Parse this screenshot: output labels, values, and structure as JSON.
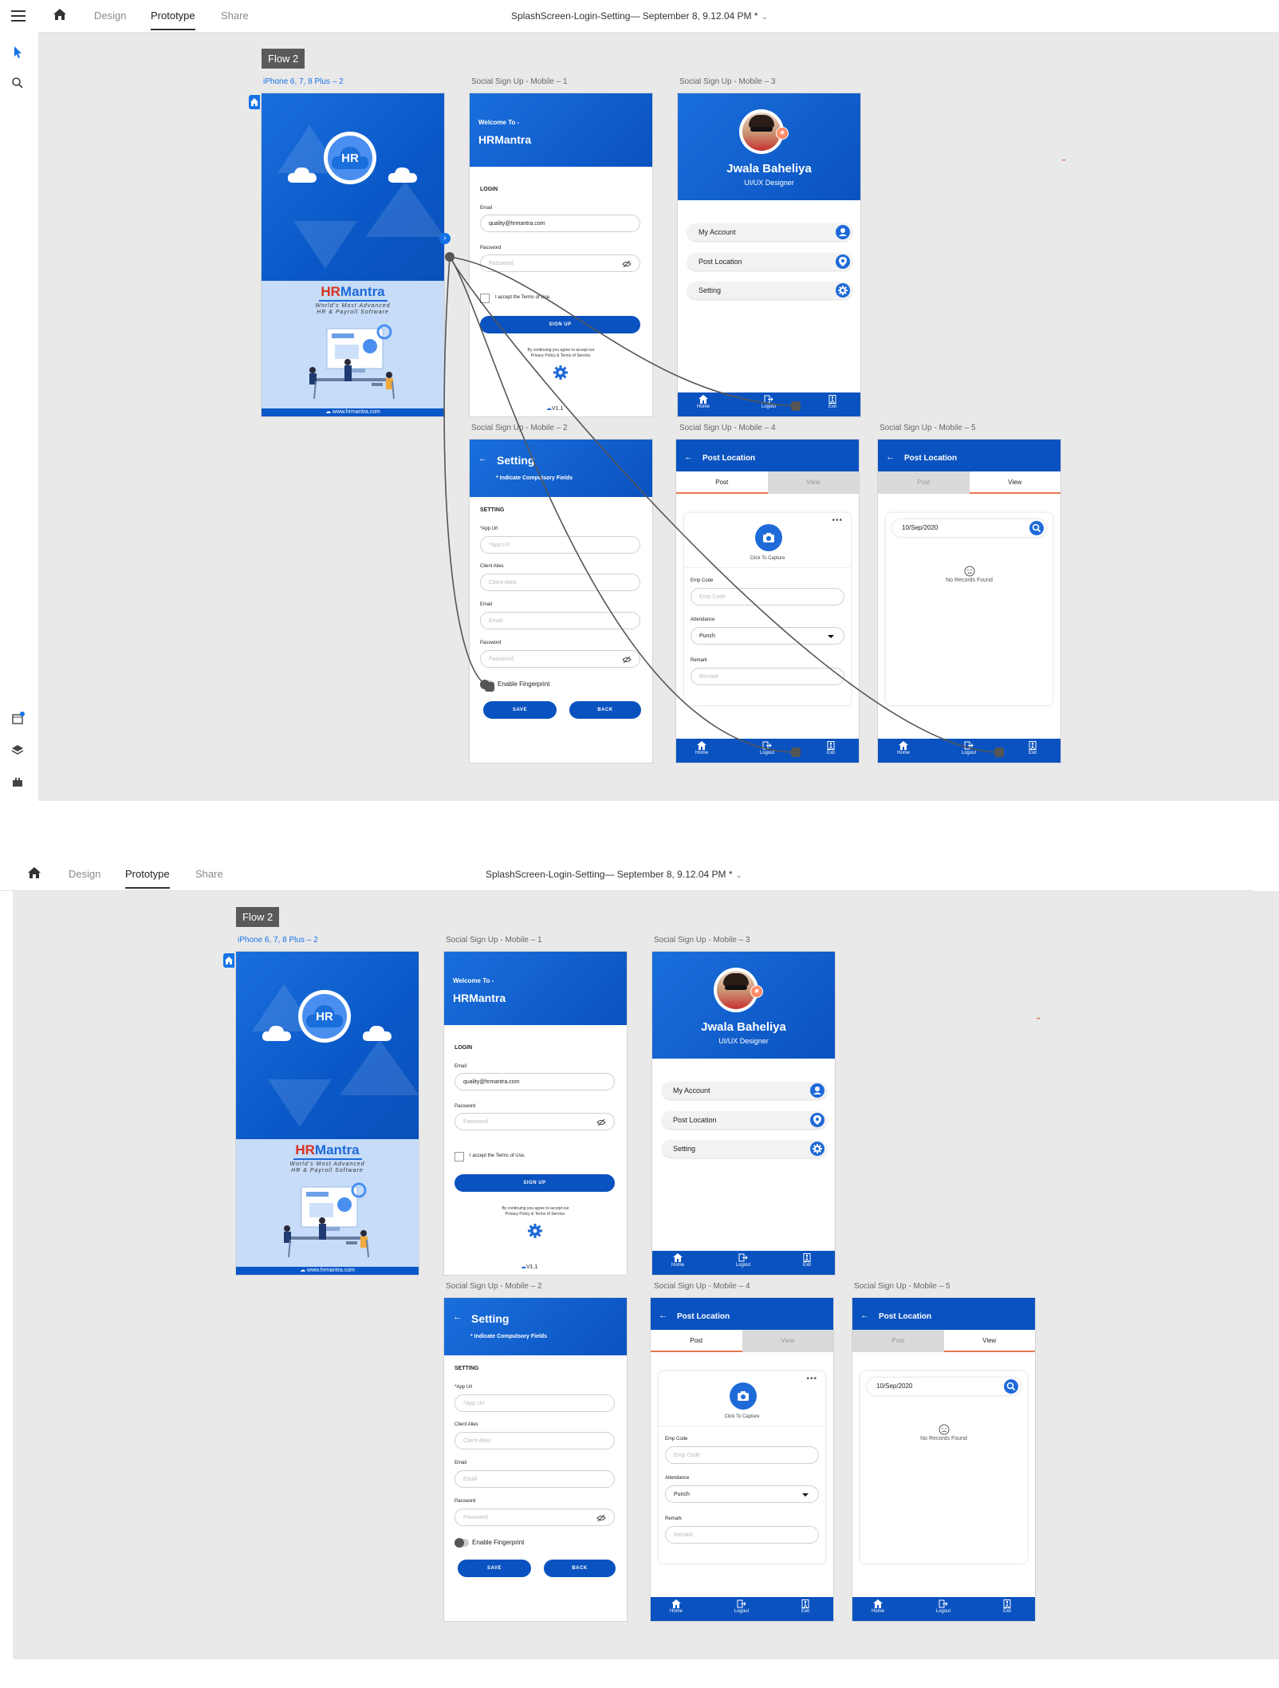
{
  "app": {
    "tabs": [
      {
        "label": "Design",
        "active": false
      },
      {
        "label": "Prototype",
        "active": true
      },
      {
        "label": "Share",
        "active": false
      }
    ],
    "doc_title": "SplashScreen-Login-Setting— September 8, 9.12.04 PM *",
    "accent": "#1473e6"
  },
  "flow": {
    "label": "Flow 2"
  },
  "artboards": {
    "splash": {
      "label": "iPhone 6, 7, 8 Plus – 2",
      "logo_text": "HR",
      "brand_hr": "HR",
      "brand_mantra": "Mantra",
      "tagline_1": "World's Most Advanced",
      "tagline_2": "HR & Payroll Software",
      "website": "www.hrmantra.com"
    },
    "login": {
      "label": "Social Sign Up - Mobile – 1",
      "welcome": "Welcome To -",
      "brand": "HRMantra",
      "section": "LOGIN",
      "email_label": "Email",
      "email_value": "quality@hrmantra.com",
      "password_label": "Password",
      "password_placeholder": "Password",
      "terms": "I accept the Terms of Use.",
      "signup": "SIGN UP",
      "fine_1": "By continuing you agree to accept our",
      "fine_2": "Privacy Policy & Terms of Service.",
      "version": "V1.1"
    },
    "profile": {
      "label": "Social Sign Up - Mobile – 3",
      "name": "Jwala Baheliya",
      "role": "UI/UX Designer",
      "menu": [
        "My Account",
        "Post Location",
        "Setting"
      ]
    },
    "setting": {
      "label": "Social Sign Up - Mobile – 2",
      "title": "Setting",
      "subtitle": "* Indicate Compulsory Fields",
      "section": "SETTING",
      "app_url_label": "*App Url",
      "app_url_placeholder": "*App Url",
      "client_label": "Client Alies",
      "client_placeholder": "Client Alies",
      "email_label": "Email",
      "email_placeholder": "Email",
      "password_label": "Password",
      "password_placeholder": "Password",
      "fingerprint": "Enable Fingerprint",
      "save": "SAVE",
      "back": "BACK"
    },
    "post": {
      "label": "Social Sign Up - Mobile – 4",
      "title": "Post Location",
      "tab_post": "Post",
      "tab_view": "View",
      "capture": "Click To Capture",
      "emp_label": "Emp Code",
      "emp_placeholder": "Emp Code",
      "att_label": "Attendance",
      "att_value": "Punch",
      "remark_label": "Remark",
      "remark_placeholder": "Remark"
    },
    "view": {
      "label": "Social Sign Up - Mobile – 5",
      "title": "Post Location",
      "tab_post": "Post",
      "tab_view": "View",
      "date_value": "10/Sep/2020",
      "empty": "No Records Found"
    }
  },
  "bottom_nav": [
    "Home",
    "Logout",
    "Exit"
  ]
}
